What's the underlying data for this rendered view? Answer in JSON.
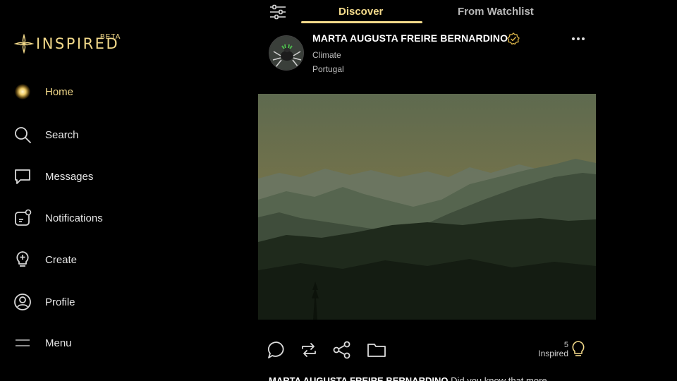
{
  "brand": {
    "name": "INSPIRED",
    "badge": "BETA",
    "accent": "#f2d98a"
  },
  "sidebar": {
    "items": [
      {
        "label": "Home",
        "icon": "home-glow-icon",
        "active": true
      },
      {
        "label": "Search",
        "icon": "search-icon"
      },
      {
        "label": "Messages",
        "icon": "message-icon"
      },
      {
        "label": "Notifications",
        "icon": "notification-icon"
      },
      {
        "label": "Create",
        "icon": "lightbulb-plus-icon"
      },
      {
        "label": "Profile",
        "icon": "user-circle-icon"
      },
      {
        "label": "Menu",
        "icon": "menu-icon"
      }
    ]
  },
  "tabs": [
    {
      "label": "Discover",
      "active": true
    },
    {
      "label": "From Watchlist",
      "active": false
    }
  ],
  "post": {
    "author": "MARTA AUGUSTA FREIRE BERNARDINO",
    "topic": "Climate",
    "location": "Portugal",
    "inspired_count": "5",
    "inspired_label": "Inspired",
    "caption_author": "MARTA AUGUSTA FREIRE BERNARDINO",
    "caption_text": "Did you know that more"
  }
}
